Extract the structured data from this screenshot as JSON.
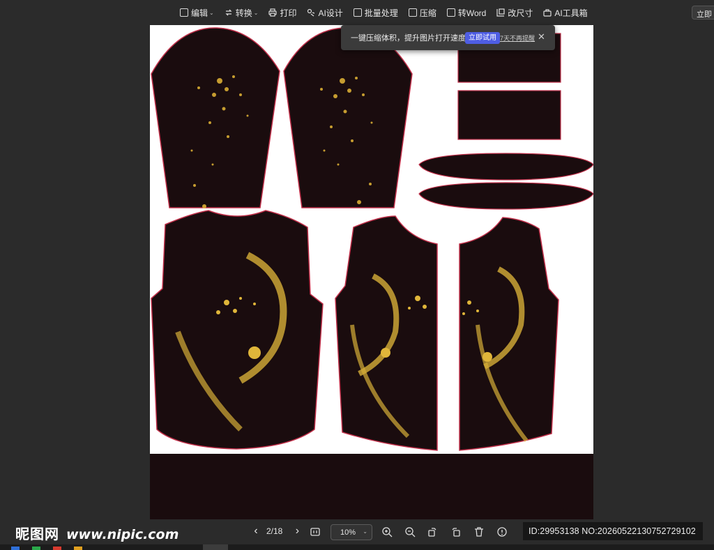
{
  "toolbar": {
    "items": [
      {
        "label": "编辑",
        "icon": "image-edit-icon",
        "dropdown": true
      },
      {
        "label": "转换",
        "icon": "convert-icon",
        "dropdown": true
      },
      {
        "label": "打印",
        "icon": "printer-icon",
        "dropdown": false
      },
      {
        "label": "AI设计",
        "icon": "ai-design-icon",
        "dropdown": false
      },
      {
        "label": "批量处理",
        "icon": "batch-icon",
        "dropdown": false
      },
      {
        "label": "压缩",
        "icon": "compress-icon",
        "dropdown": false
      },
      {
        "label": "转Word",
        "icon": "word-icon",
        "dropdown": false
      },
      {
        "label": "改尺寸",
        "icon": "resize-icon",
        "dropdown": false
      },
      {
        "label": "AI工具箱",
        "icon": "toolbox-icon",
        "dropdown": false
      }
    ],
    "right_button": "立即"
  },
  "banner": {
    "text": "一键压缩体积，提升图片打开速度",
    "try_button": "立即试用",
    "dismiss_link": "7天不再提醒",
    "close_icon": "close-icon"
  },
  "bottom": {
    "logo_cn": "昵图网",
    "logo_url": "www.nipic.com",
    "page_indicator": "2/18",
    "zoom": "10%",
    "id_text": "ID:29953138 NO:20260522130752729102"
  },
  "colors": {
    "background": "#2b2b2b",
    "garment": "#1a0c0e",
    "outline": "#c0304a",
    "gold": "#e0b63a",
    "accent": "#4e5de3"
  }
}
